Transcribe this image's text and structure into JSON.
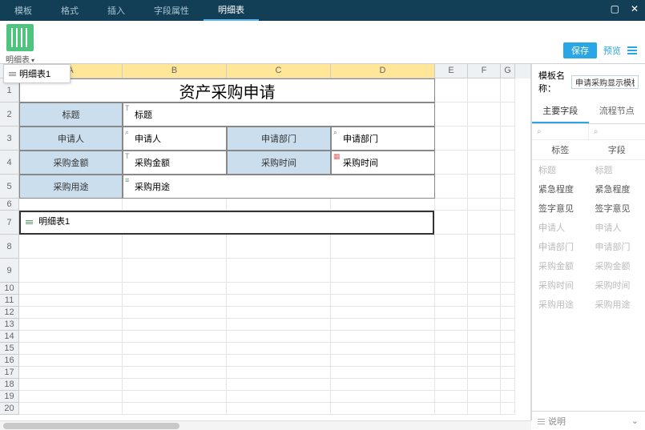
{
  "menu": {
    "tabs": [
      "模板",
      "格式",
      "插入",
      "字段属性",
      "明细表"
    ],
    "active": 4
  },
  "toolbar": {
    "detail_btn": "明细表"
  },
  "dropdown": {
    "item": "明细表1"
  },
  "actions": {
    "save": "保存",
    "preview": "预览"
  },
  "columns": {
    "letters": [
      "A",
      "B",
      "C",
      "D",
      "E",
      "F",
      "G"
    ],
    "widths": [
      129,
      130,
      130,
      130,
      41,
      41,
      18
    ],
    "selected": [
      0,
      1,
      2,
      3
    ]
  },
  "rows": {
    "count": 20,
    "tall": [
      1,
      2,
      3,
      4,
      5,
      7,
      8,
      9
    ]
  },
  "form": {
    "title": "资产采购申请",
    "r2": {
      "a": "标题",
      "b": "标题"
    },
    "r3": {
      "a": "申请人",
      "b": "申请人",
      "c": "申请部门",
      "d": "申请部门"
    },
    "r4": {
      "a": "采购金额",
      "b": "采购金额",
      "c": "采购时间",
      "d": "采购时间"
    },
    "r5": {
      "a": "采购用途",
      "b": "采购用途"
    },
    "detail": "明细表1"
  },
  "sidebar": {
    "tpl_label": "模板名称：",
    "tpl_name": "申请采购显示模板",
    "tabs": {
      "main": "主要字段",
      "flow": "流程节点",
      "active": 0
    },
    "headers": {
      "label": "标签",
      "field": "字段"
    },
    "search_icon": "⌕",
    "fields": [
      {
        "label": "标题",
        "field": "标题",
        "used": true
      },
      {
        "label": "紧急程度",
        "field": "紧急程度",
        "used": false
      },
      {
        "label": "签字意见",
        "field": "签字意见",
        "used": false
      },
      {
        "label": "申请人",
        "field": "申请人",
        "used": true
      },
      {
        "label": "申请部门",
        "field": "申请部门",
        "used": true
      },
      {
        "label": "采购金额",
        "field": "采购金额",
        "used": true
      },
      {
        "label": "采购时间",
        "field": "采购时间",
        "used": true
      },
      {
        "label": "采购用途",
        "field": "采购用途",
        "used": true
      }
    ]
  },
  "footer": {
    "label": "说明",
    "chevron": "⌄"
  }
}
